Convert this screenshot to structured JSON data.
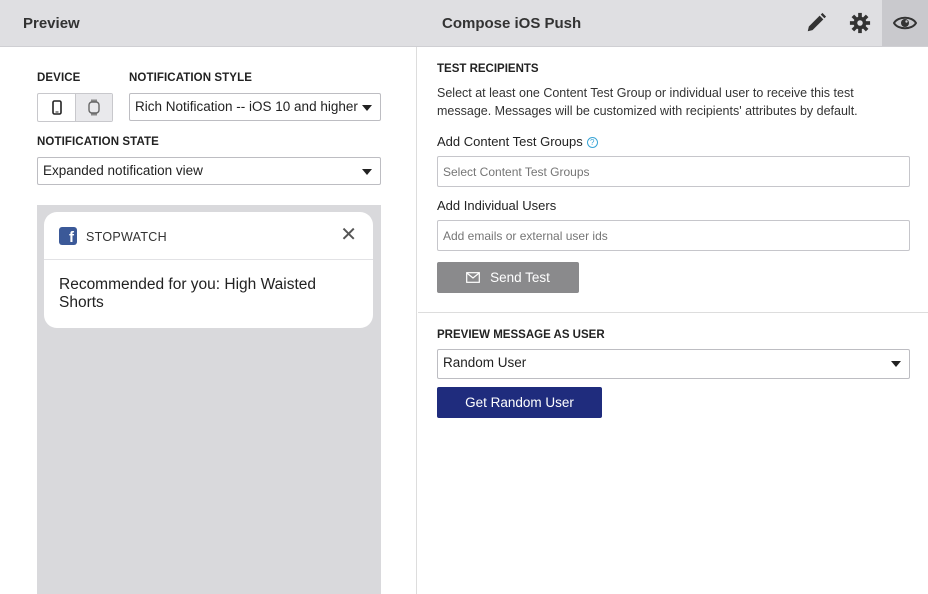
{
  "header": {
    "left_title": "Preview",
    "center_title": "Compose iOS Push",
    "icons": [
      "pencil-icon",
      "gear-icon",
      "eye-icon"
    ]
  },
  "left": {
    "device_label": "DEVICE",
    "style_label": "NOTIFICATION STYLE",
    "style_value": "Rich Notification -- iOS 10 and higher",
    "state_label": "NOTIFICATION STATE",
    "state_value": "Expanded notification view",
    "notification": {
      "app_name": "STOPWATCH",
      "message": "Recommended for you: High Waisted Shorts"
    }
  },
  "right": {
    "test_label": "TEST RECIPIENTS",
    "test_desc": "Select at least one Content Test Group or individual user to receive this test message. Messages will be customized with recipients' attributes by default.",
    "groups_label": "Add Content Test Groups",
    "groups_placeholder": "Select Content Test Groups",
    "users_label": "Add Individual Users",
    "users_placeholder": "Add emails or external user ids",
    "send_label": "Send Test",
    "preview_label": "PREVIEW MESSAGE AS USER",
    "preview_value": "Random User",
    "random_label": "Get Random User"
  },
  "colors": {
    "header_bg": "#dfdfe2",
    "primary_button": "#1f2c7d",
    "disabled_button": "#8a8a8c",
    "facebook_blue": "#3b5998"
  }
}
